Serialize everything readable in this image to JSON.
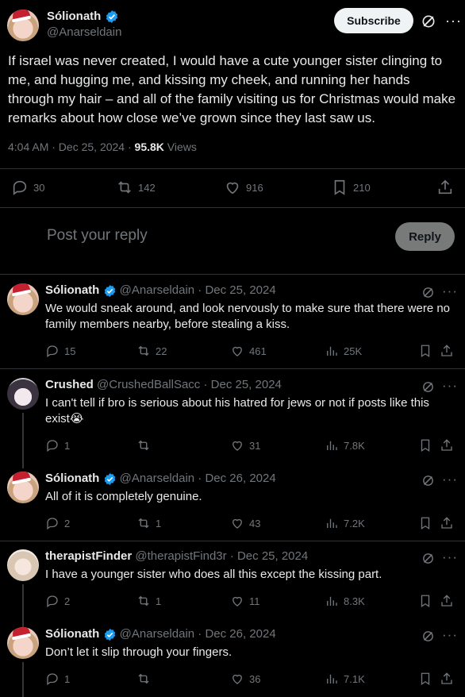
{
  "main_post": {
    "display_name": "Sólionath",
    "handle": "@Anarseldain",
    "subscribe_label": "Subscribe",
    "text": "If israel was never created, I would have a cute younger sister clinging to me, and hugging me, and kissing my cheek, and running her hands through my hair – and all of the family visiting us for Christmas would make remarks about how close we’ve grown since they last saw us.",
    "time": "4:04 AM · Dec 25, 2024 · ",
    "views_count": "95.8K",
    "views_label": " Views",
    "replies": "30",
    "reposts": "142",
    "likes": "916",
    "bookmarks": "210"
  },
  "reply_box": {
    "placeholder": "Post your reply",
    "button_label": "Reply"
  },
  "replies": [
    {
      "display_name": "Sólionath",
      "handle": "@Anarseldain",
      "date": "· Dec 25, 2024",
      "text": "We would sneak around, and look nervously to make sure that there were no family members nearby, before stealing a kiss.",
      "replies": "15",
      "reposts": "22",
      "likes": "461",
      "views": "25K"
    },
    {
      "display_name": "Crushed",
      "handle": "@CrushedBallSacc",
      "date": "· Dec 25, 2024",
      "text": "I can't tell if bro is serious about his hatred for jews or not if posts like this exist😭",
      "replies": "1",
      "reposts": "",
      "likes": "31",
      "views": "7.8K"
    },
    {
      "display_name": "Sólionath",
      "handle": "@Anarseldain",
      "date": "· Dec 26, 2024",
      "text": "All of it is completely genuine.",
      "replies": "2",
      "reposts": "1",
      "likes": "43",
      "views": "7.2K"
    },
    {
      "display_name": "therapistFinder",
      "handle": "@therapistFind3r",
      "date": "· Dec 25, 2024",
      "text": "I have a younger sister who does all this except the kissing part.",
      "replies": "2",
      "reposts": "1",
      "likes": "11",
      "views": "8.3K"
    },
    {
      "display_name": "Sólionath",
      "handle": "@Anarseldain",
      "date": "· Dec 26, 2024",
      "text": "Don’t let it slip through your fingers.",
      "replies": "1",
      "reposts": "",
      "likes": "36",
      "views": "7.1K"
    }
  ],
  "colors": {
    "background": "#000000",
    "text": "#e7e9ea",
    "muted": "#71767b",
    "verified": "#1d9bf0",
    "divider": "#2f3336"
  },
  "icons": [
    "reply-icon",
    "repost-icon",
    "like-icon",
    "bookmark-icon",
    "share-icon",
    "views-icon",
    "grok-icon",
    "verified-icon",
    "more-icon"
  ]
}
